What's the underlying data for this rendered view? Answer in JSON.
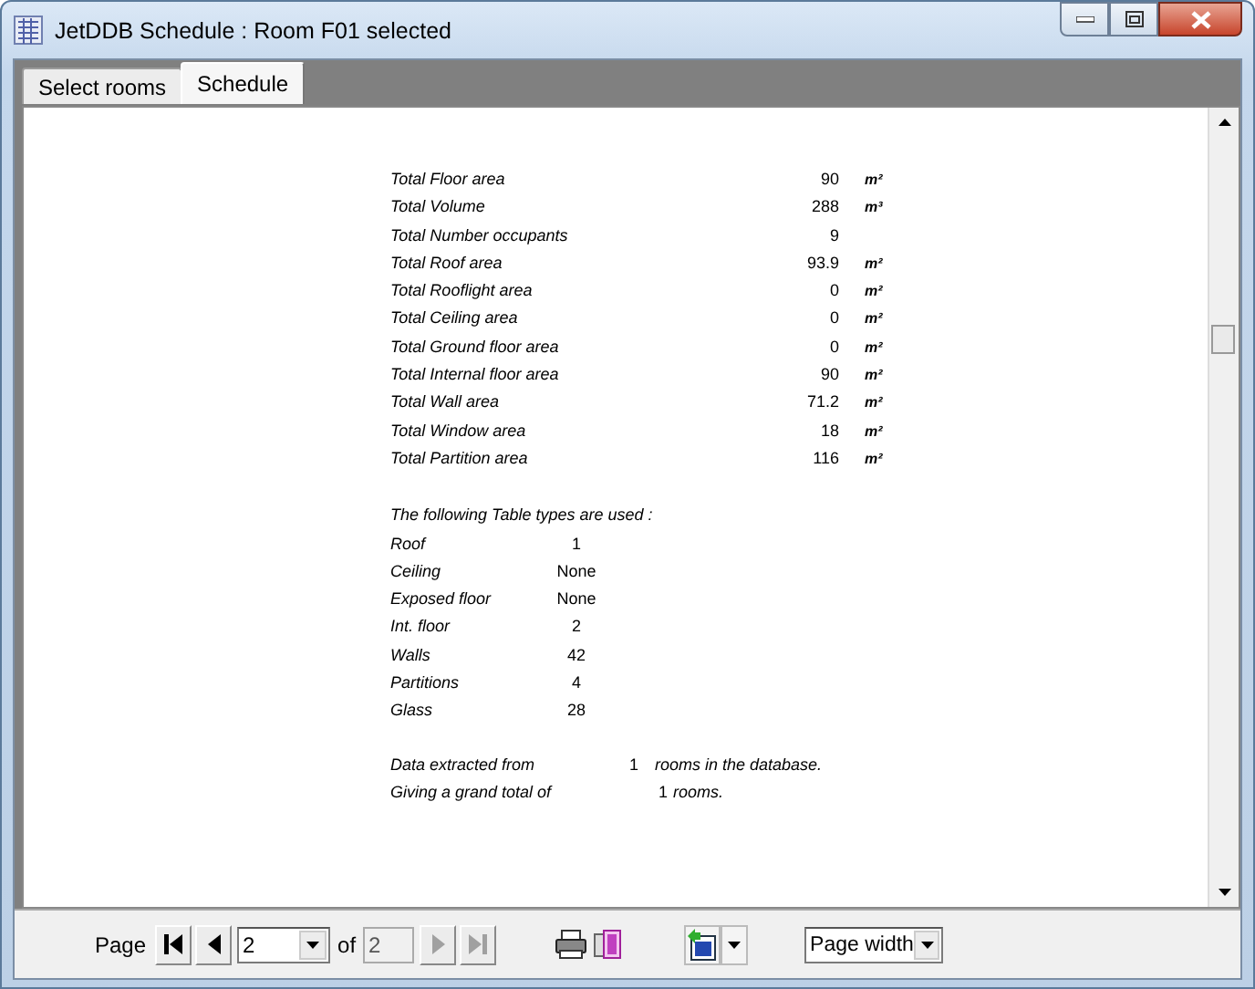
{
  "window": {
    "title": "JetDDB Schedule : Room F01 selected"
  },
  "tabs": [
    {
      "label": "Select rooms",
      "selected": false
    },
    {
      "label": "Schedule",
      "selected": true
    }
  ],
  "report": {
    "totals": [
      {
        "label": "Total Floor area",
        "value": "90",
        "unit": "m²"
      },
      {
        "label": "Total Volume",
        "value": "288",
        "unit": "m³"
      },
      {
        "label": "Total Number occupants",
        "value": "9"
      },
      {
        "label": "Total Roof area",
        "value": "93.9",
        "unit": "m²"
      },
      {
        "label": "Total Rooflight area",
        "value": "0",
        "unit": "m²"
      },
      {
        "label": "Total Ceiling area",
        "value": "0",
        "unit": "m²"
      },
      {
        "label": "Total Ground floor area",
        "value": "0",
        "unit": "m²"
      },
      {
        "label": "Total Internal floor area",
        "value": "90",
        "unit": "m²"
      },
      {
        "label": "Total Wall area",
        "value": "71.2",
        "unit": "m²"
      },
      {
        "label": "Total Window area",
        "value": "18",
        "unit": "m²"
      },
      {
        "label": "Total Partition area",
        "value": "116",
        "unit": "m²"
      }
    ],
    "table_types_heading": "The following Table types are used :",
    "table_types": [
      {
        "label": "Roof",
        "value": "1"
      },
      {
        "label": "Ceiling",
        "value": "None"
      },
      {
        "label": "Exposed floor",
        "value": "None"
      },
      {
        "label": "Int. floor",
        "value": "2"
      },
      {
        "label": "Walls",
        "value": "42"
      },
      {
        "label": "Partitions",
        "value": "4"
      },
      {
        "label": "Glass",
        "value": "28"
      }
    ],
    "summary": [
      {
        "label": "Data extracted from",
        "value": "1",
        "text": "rooms in the database."
      },
      {
        "label": "Giving a grand total of",
        "value": "1",
        "text": "rooms."
      }
    ]
  },
  "toolbar": {
    "page_label": "Page",
    "page_value": "2",
    "of_label": "of",
    "page_count": "2",
    "nav_buttons": [
      {
        "kind": "first",
        "disabled": false
      },
      {
        "kind": "prev",
        "disabled": false
      },
      {
        "kind": "next",
        "disabled": true
      },
      {
        "kind": "last",
        "disabled": true
      }
    ],
    "zoom": "Page width"
  }
}
